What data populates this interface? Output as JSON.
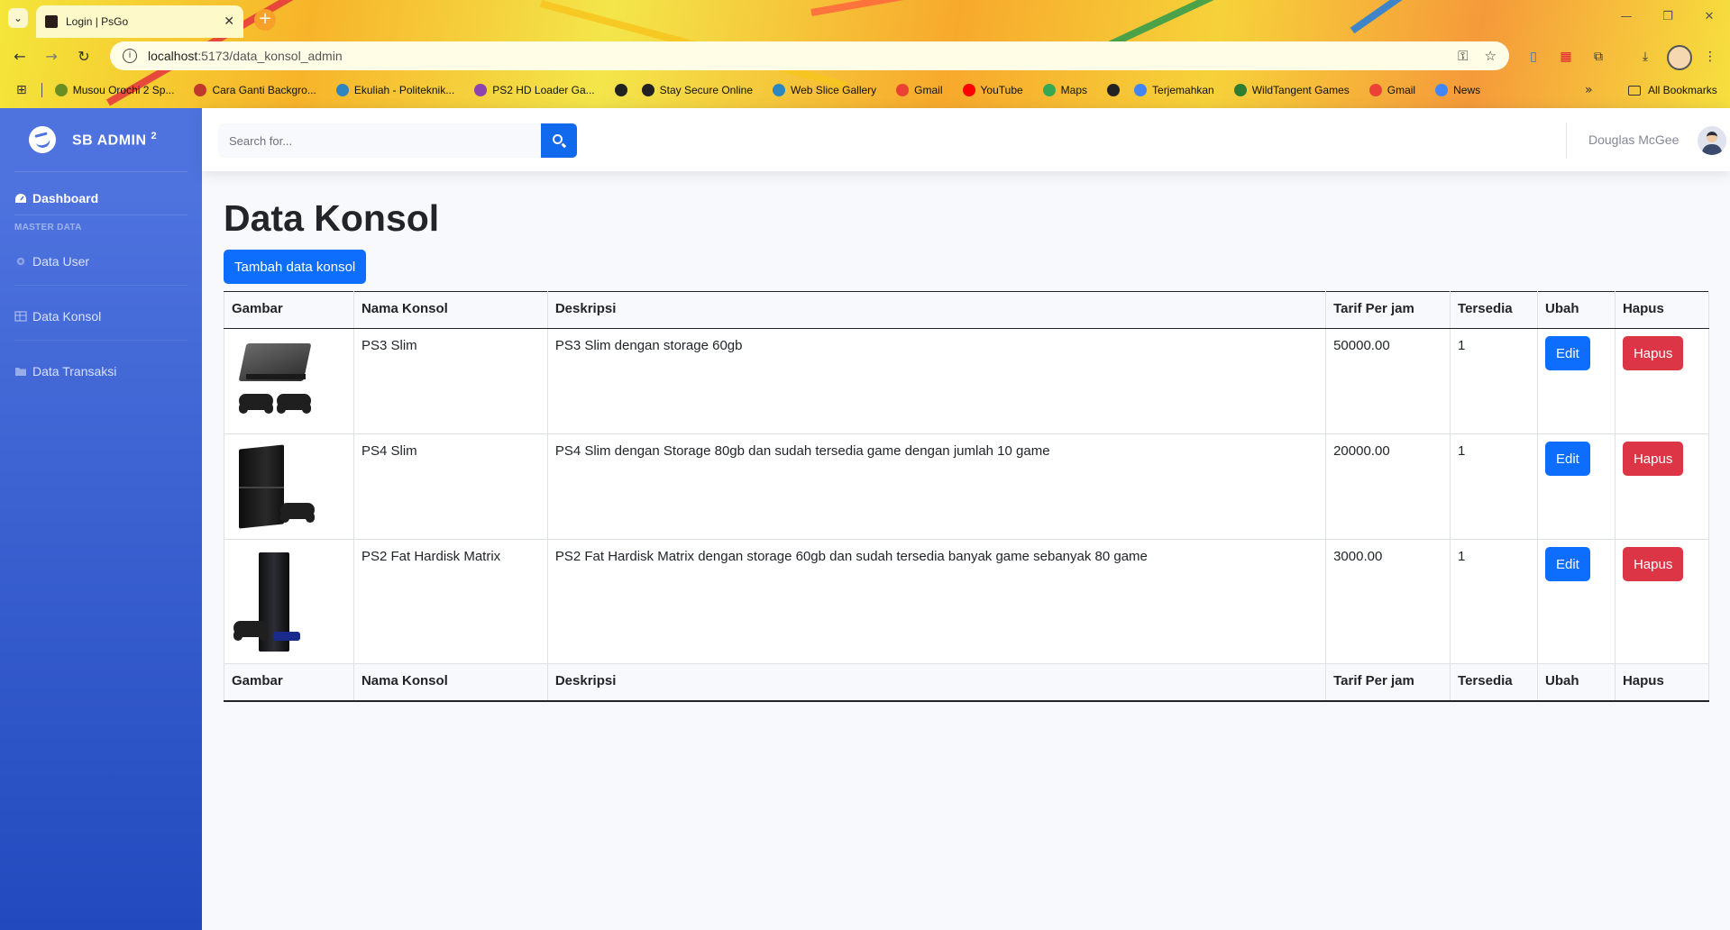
{
  "browser": {
    "tab_title": "Login | PsGo",
    "tab_close": "✕",
    "new_tab": "+",
    "tab_list": "⌄",
    "url_host": "localhost",
    "url_path": ":5173/data_konsol_admin",
    "nav": {
      "back": "←",
      "forward": "→",
      "reload": "↻"
    },
    "window": {
      "minimize": "—",
      "maximize": "❐",
      "close": "✕"
    },
    "bookmarks": [
      {
        "label": "Musou Orochi 2 Sp...",
        "color": "#6b8e23"
      },
      {
        "label": "Cara Ganti Backgro...",
        "color": "#c0392b"
      },
      {
        "label": "Ekuliah - Politeknik...",
        "color": "#2e86c1"
      },
      {
        "label": "PS2 HD Loader Ga...",
        "color": "#8e44ad"
      },
      {
        "label": "",
        "color": "#222222"
      },
      {
        "label": "Stay Secure Online",
        "color": "#222222"
      },
      {
        "label": "Web Slice Gallery",
        "color": "#2e86c1"
      },
      {
        "label": "Gmail",
        "color": "#ea4335"
      },
      {
        "label": "YouTube",
        "color": "#ff0000"
      },
      {
        "label": "Maps",
        "color": "#34a853"
      },
      {
        "label": "",
        "color": "#222222"
      },
      {
        "label": "Terjemahkan",
        "color": "#4285f4"
      },
      {
        "label": "WildTangent Games",
        "color": "#2e7d32"
      },
      {
        "label": "Gmail",
        "color": "#ea4335"
      },
      {
        "label": "News",
        "color": "#4285f4"
      }
    ],
    "more": "»",
    "all_bookmarks": "All Bookmarks"
  },
  "sidebar": {
    "brand": "SB ADMIN",
    "brand_sup": "2",
    "dashboard": "Dashboard",
    "heading": "MASTER DATA",
    "items": [
      "Data User",
      "Data Konsol",
      "Data Transaksi"
    ]
  },
  "topbar": {
    "search_placeholder": "Search for...",
    "user_name": "Douglas McGee"
  },
  "main": {
    "title": "Data Konsol",
    "add_button": "Tambah data konsol",
    "columns": [
      "Gambar",
      "Nama Konsol",
      "Deskripsi",
      "Tarif Per jam",
      "Tersedia",
      "Ubah",
      "Hapus"
    ],
    "rows": [
      {
        "name": "PS3 Slim",
        "description": "PS3 Slim dengan storage 60gb",
        "rate": "50000.00",
        "available": "1",
        "edit": "Edit",
        "delete": "Hapus",
        "image": "ps3-slim-console-image"
      },
      {
        "name": "PS4 Slim",
        "description": "PS4 Slim dengan Storage 80gb dan sudah tersedia game dengan jumlah 10 game",
        "rate": "20000.00",
        "available": "1",
        "edit": "Edit",
        "delete": "Hapus",
        "image": "ps4-slim-console-image"
      },
      {
        "name": "PS2 Fat Hardisk Matrix",
        "description": "PS2 Fat Hardisk Matrix dengan storage 60gb dan sudah tersedia banyak game sebanyak 80 game",
        "rate": "3000.00",
        "available": "1",
        "edit": "Edit",
        "delete": "Hapus",
        "image": "ps2-fat-console-image"
      }
    ]
  },
  "colors": {
    "sidebar_top": "#4e73df",
    "sidebar_bottom": "#224abe",
    "primary": "#0d6efd",
    "danger": "#dc3545"
  }
}
